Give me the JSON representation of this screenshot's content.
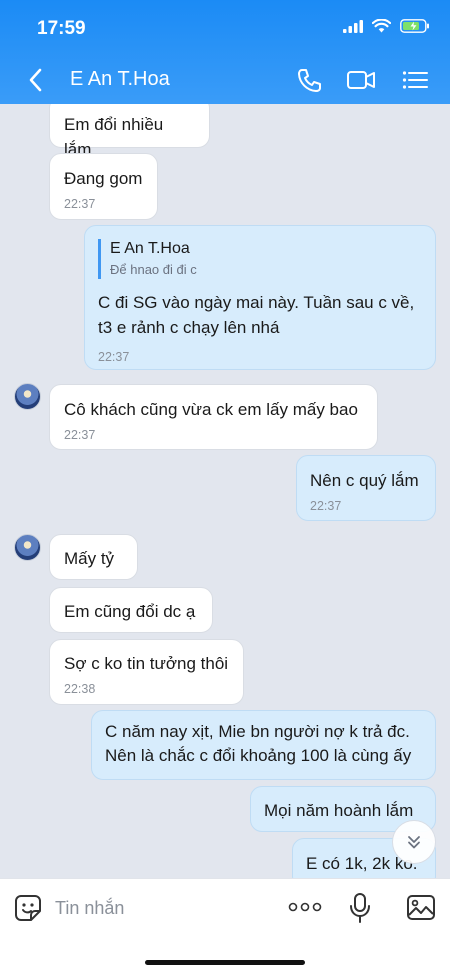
{
  "status": {
    "time": "17:59"
  },
  "header": {
    "title": "E An T.Hoa"
  },
  "messages": [
    {
      "dir": "in",
      "text": "Em đổi nhiều lắm"
    },
    {
      "dir": "in",
      "text": "Đang gom",
      "time": "22:37"
    },
    {
      "dir": "out",
      "quote_name": "E An T.Hoa",
      "quote_text": "Để hnao đi đi c",
      "text": "C đi SG vào ngày mai này. Tuần sau c về, t3 e rảnh c chạy lên nhá",
      "time": "22:37"
    },
    {
      "dir": "in",
      "text": "Cô khách cũng vừa ck em lấy mấy bao",
      "time": "22:37"
    },
    {
      "dir": "out",
      "text": "Nên c quý lắm",
      "time": "22:37"
    },
    {
      "dir": "in",
      "text": "Mấy tỷ"
    },
    {
      "dir": "in",
      "text": "Em cũng đổi dc ạ"
    },
    {
      "dir": "in",
      "text": "Sợ c ko tin tưởng thôi",
      "time": "22:38"
    },
    {
      "dir": "out",
      "text": "C năm nay xịt, Mie bn người nợ k trả đc. Nên là chắc c đổi khoảng 100 là cùng ấy"
    },
    {
      "dir": "out",
      "text": "Mọi năm hoành lắm"
    },
    {
      "dir": "out",
      "text": "E có 1k, 2k ko."
    }
  ],
  "input": {
    "placeholder": "Tin nhắn"
  },
  "icons": [
    "back-icon",
    "phone-icon",
    "video-icon",
    "menu-icon",
    "sticker-icon",
    "more-icon",
    "mic-icon",
    "image-icon",
    "scroll-down-icon"
  ]
}
